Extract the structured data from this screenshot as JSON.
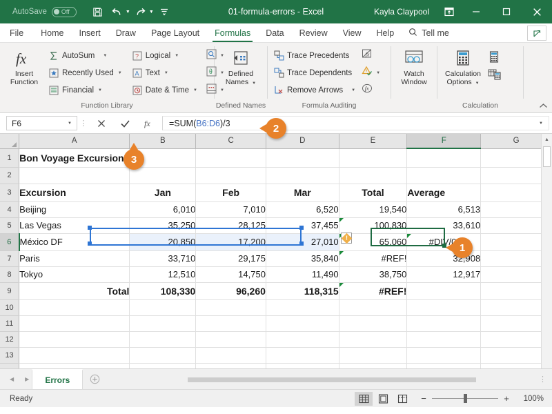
{
  "titlebar": {
    "autosave_label": "AutoSave",
    "autosave_state": "Off",
    "document_title": "01-formula-errors  -  Excel",
    "username": "Kayla Claypool",
    "save_icon": "save-icon",
    "undo_icon": "undo-icon",
    "redo_icon": "redo-icon",
    "customize_icon": "customize-qat-icon",
    "restore_up_icon": "ribbon-display-options-icon",
    "minimize_icon": "minimize-icon",
    "maximize_icon": "maximize-icon",
    "close_icon": "close-icon",
    "bg_color": "#217346"
  },
  "tabs": [
    {
      "label": "File",
      "active": false
    },
    {
      "label": "Home",
      "active": false
    },
    {
      "label": "Insert",
      "active": false
    },
    {
      "label": "Draw",
      "active": false
    },
    {
      "label": "Page Layout",
      "active": false
    },
    {
      "label": "Formulas",
      "active": true
    },
    {
      "label": "Data",
      "active": false
    },
    {
      "label": "Review",
      "active": false
    },
    {
      "label": "View",
      "active": false
    },
    {
      "label": "Help",
      "active": false
    }
  ],
  "tellme": {
    "label": "Tell me",
    "icon": "search-icon"
  },
  "share": {
    "icon": "share-icon"
  },
  "ribbon": {
    "groups": [
      {
        "label": "Function Library",
        "big_button": {
          "label_line1": "Insert",
          "label_line2": "Function",
          "icon": "fx-icon"
        },
        "menu_items_col1": [
          {
            "label": "AutoSum",
            "icon": "autosum-sigma-icon",
            "caret": true
          },
          {
            "label": "Recently Used",
            "icon": "recently-used-icon",
            "caret": true
          },
          {
            "label": "Financial",
            "icon": "financial-icon",
            "caret": true
          }
        ],
        "menu_items_col2": [
          {
            "label": "Logical",
            "icon": "logical-icon",
            "caret": true
          },
          {
            "label": "Text",
            "icon": "text-function-icon",
            "caret": true
          },
          {
            "label": "Date & Time",
            "icon": "date-time-icon",
            "caret": true
          }
        ],
        "icon_col": [
          {
            "icon": "lookup-reference-icon",
            "caret": true
          },
          {
            "icon": "math-trig-icon",
            "caret": true
          },
          {
            "icon": "more-functions-icon",
            "caret": true
          }
        ]
      },
      {
        "label": "Defined Names",
        "big_button": {
          "label_line1": "Defined",
          "label_line2": "Names",
          "icon": "defined-names-icon",
          "caret": true
        }
      },
      {
        "label": "Formula Auditing",
        "menu_items": [
          {
            "label": "Trace Precedents",
            "icon": "trace-precedents-icon"
          },
          {
            "label": "Trace Dependents",
            "icon": "trace-dependents-icon"
          },
          {
            "label": "Remove Arrows",
            "icon": "remove-arrows-icon",
            "caret": true
          }
        ],
        "icon_col": [
          {
            "icon": "show-formulas-icon"
          },
          {
            "icon": "error-checking-icon",
            "caret": true
          },
          {
            "icon": "evaluate-formula-icon"
          }
        ]
      },
      {
        "label": "",
        "big_button": {
          "label_line1": "Watch",
          "label_line2": "Window",
          "icon": "watch-window-icon"
        }
      },
      {
        "label": "Calculation",
        "big_button": {
          "label_line1": "Calculation",
          "label_line2": "Options",
          "icon": "calculation-options-icon",
          "caret": true
        },
        "icon_col": [
          {
            "icon": "calculate-now-icon"
          },
          {
            "icon": "calculate-sheet-icon"
          }
        ]
      }
    ],
    "collapse_icon": "collapse-ribbon-icon"
  },
  "formula_bar": {
    "name_box_value": "F6",
    "cancel_icon": "cancel-x-icon",
    "enter_icon": "enter-check-icon",
    "insert_function_icon": "fx-icon",
    "formula_prefix": "=SUM(",
    "formula_reference": "B6:D6",
    "formula_suffix": ")/3",
    "expand_icon": "expand-formula-bar-icon"
  },
  "grid": {
    "column_headers": [
      "A",
      "B",
      "C",
      "D",
      "E",
      "F",
      "G"
    ],
    "selected_column": "F",
    "selected_row": "6",
    "active_cell": "F6",
    "row_numbers": [
      "1",
      "2",
      "3",
      "4",
      "5",
      "6",
      "7",
      "8",
      "9",
      "10",
      "11",
      "12",
      "13"
    ],
    "rows": [
      {
        "num": "1",
        "cells": [
          {
            "col": "A",
            "value": "Bon Voyage Excursions",
            "align": "left",
            "bold": true,
            "overflow": true
          },
          {
            "col": "B",
            "value": ""
          },
          {
            "col": "C",
            "value": ""
          },
          {
            "col": "D",
            "value": ""
          },
          {
            "col": "E",
            "value": ""
          },
          {
            "col": "F",
            "value": ""
          },
          {
            "col": "G",
            "value": ""
          }
        ]
      },
      {
        "num": "2",
        "cells": [
          {
            "col": "A",
            "value": ""
          },
          {
            "col": "B",
            "value": ""
          },
          {
            "col": "C",
            "value": ""
          },
          {
            "col": "D",
            "value": ""
          },
          {
            "col": "E",
            "value": ""
          },
          {
            "col": "F",
            "value": ""
          },
          {
            "col": "G",
            "value": ""
          }
        ]
      },
      {
        "num": "3",
        "cells": [
          {
            "col": "A",
            "value": "Excursion",
            "align": "left",
            "bold": true
          },
          {
            "col": "B",
            "value": "Jan",
            "align": "center",
            "bold": true
          },
          {
            "col": "C",
            "value": "Feb",
            "align": "center",
            "bold": true
          },
          {
            "col": "D",
            "value": "Mar",
            "align": "center",
            "bold": true
          },
          {
            "col": "E",
            "value": "Total",
            "align": "center",
            "bold": true
          },
          {
            "col": "F",
            "value": "Average",
            "align": "left",
            "bold": true
          },
          {
            "col": "G",
            "value": ""
          }
        ]
      },
      {
        "num": "4",
        "cells": [
          {
            "col": "A",
            "value": "Beijing",
            "align": "left"
          },
          {
            "col": "B",
            "value": "6,010",
            "align": "right"
          },
          {
            "col": "C",
            "value": "7,010",
            "align": "right"
          },
          {
            "col": "D",
            "value": "6,520",
            "align": "right"
          },
          {
            "col": "E",
            "value": "19,540",
            "align": "right"
          },
          {
            "col": "F",
            "value": "6,513",
            "align": "right"
          },
          {
            "col": "G",
            "value": ""
          }
        ]
      },
      {
        "num": "5",
        "cells": [
          {
            "col": "A",
            "value": "Las Vegas",
            "align": "left"
          },
          {
            "col": "B",
            "value": "35,250",
            "align": "right"
          },
          {
            "col": "C",
            "value": "28,125",
            "align": "right"
          },
          {
            "col": "D",
            "value": "37,455",
            "align": "right"
          },
          {
            "col": "E",
            "value": "100,830",
            "align": "right",
            "error_triangle": true
          },
          {
            "col": "F",
            "value": "33,610",
            "align": "right"
          },
          {
            "col": "G",
            "value": ""
          }
        ]
      },
      {
        "num": "6",
        "cells": [
          {
            "col": "A",
            "value": "México DF",
            "align": "left"
          },
          {
            "col": "B",
            "value": "20,850",
            "align": "right",
            "highlight": true
          },
          {
            "col": "C",
            "value": "17,200",
            "align": "right",
            "highlight": true
          },
          {
            "col": "D",
            "value": "27,010",
            "align": "right",
            "highlight": true
          },
          {
            "col": "E",
            "value": "65,060",
            "align": "right",
            "error_triangle": true,
            "warning_icon": true
          },
          {
            "col": "F",
            "value": "#DIV/0!",
            "align": "center",
            "error_triangle": true
          },
          {
            "col": "G",
            "value": ""
          }
        ]
      },
      {
        "num": "7",
        "cells": [
          {
            "col": "A",
            "value": "Paris",
            "align": "left"
          },
          {
            "col": "B",
            "value": "33,710",
            "align": "right"
          },
          {
            "col": "C",
            "value": "29,175",
            "align": "right"
          },
          {
            "col": "D",
            "value": "35,840",
            "align": "right"
          },
          {
            "col": "E",
            "value": "#REF!",
            "align": "right",
            "error_triangle": true
          },
          {
            "col": "F",
            "value": "32,908",
            "align": "right"
          },
          {
            "col": "G",
            "value": ""
          }
        ]
      },
      {
        "num": "8",
        "cells": [
          {
            "col": "A",
            "value": "Tokyo",
            "align": "left"
          },
          {
            "col": "B",
            "value": "12,510",
            "align": "right"
          },
          {
            "col": "C",
            "value": "14,750",
            "align": "right"
          },
          {
            "col": "D",
            "value": "11,490",
            "align": "right"
          },
          {
            "col": "E",
            "value": "38,750",
            "align": "right"
          },
          {
            "col": "F",
            "value": "12,917",
            "align": "right"
          },
          {
            "col": "G",
            "value": ""
          }
        ]
      },
      {
        "num": "9",
        "cells": [
          {
            "col": "A",
            "value": "Total",
            "align": "right",
            "bold": true
          },
          {
            "col": "B",
            "value": "108,330",
            "align": "right",
            "bold": true
          },
          {
            "col": "C",
            "value": "96,260",
            "align": "right",
            "bold": true
          },
          {
            "col": "D",
            "value": "118,315",
            "align": "right",
            "bold": true
          },
          {
            "col": "E",
            "value": "#REF!",
            "align": "right",
            "bold": true,
            "error_triangle": true
          },
          {
            "col": "F",
            "value": "",
            "align": "right"
          },
          {
            "col": "G",
            "value": ""
          }
        ]
      },
      {
        "num": "10",
        "cells": []
      },
      {
        "num": "11",
        "cells": []
      },
      {
        "num": "12",
        "cells": []
      },
      {
        "num": "13",
        "cells": []
      }
    ],
    "reference_range": "B6:D6"
  },
  "sheet_tabs": {
    "prev_icon": "previous-sheet-icon",
    "next_icon": "next-sheet-icon",
    "sheets": [
      {
        "name": "Errors",
        "active": true
      }
    ],
    "add_sheet_icon": "add-sheet-plus-icon"
  },
  "status_bar": {
    "status_text": "Ready",
    "view_buttons": [
      {
        "icon": "normal-view-icon",
        "active": true
      },
      {
        "icon": "page-layout-view-icon",
        "active": false
      },
      {
        "icon": "page-break-preview-icon",
        "active": false
      }
    ],
    "zoom_out_label": "−",
    "zoom_in_label": "+",
    "zoom_level": "100%"
  },
  "callouts": [
    {
      "number": "1",
      "direction": "left",
      "target": "F6-cell"
    },
    {
      "number": "2",
      "direction": "left",
      "target": "formula-bar"
    },
    {
      "number": "3",
      "direction": "up",
      "target": "enter-check-button"
    }
  ],
  "colors": {
    "excel_green": "#217346",
    "callout_orange": "#e8822a",
    "reference_blue": "#4472c4",
    "selection_blue": "#2e75d4",
    "error_green": "#1a8a3a"
  }
}
